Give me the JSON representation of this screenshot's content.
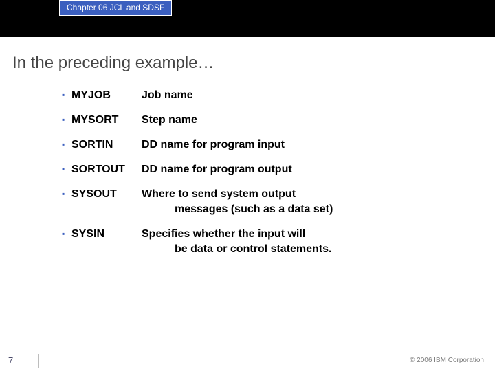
{
  "header": {
    "chapter": "Chapter 06 JCL and SDSF"
  },
  "title": "In the preceding example…",
  "items": [
    {
      "term": "MYJOB",
      "desc": "Job name"
    },
    {
      "term": "MYSORT",
      "desc": "Step name"
    },
    {
      "term": "SORTIN",
      "desc": "DD name for program input"
    },
    {
      "term": "SORTOUT",
      "desc": "DD name for program output"
    },
    {
      "term": "SYSOUT",
      "desc": "Where to send system output",
      "desc2": "messages (such as a data set)"
    },
    {
      "term": "SYSIN",
      "desc": "Specifies whether the input will",
      "desc2": "be data or control statements."
    }
  ],
  "footer": {
    "page": "7",
    "copyright": "© 2006 IBM Corporation"
  }
}
